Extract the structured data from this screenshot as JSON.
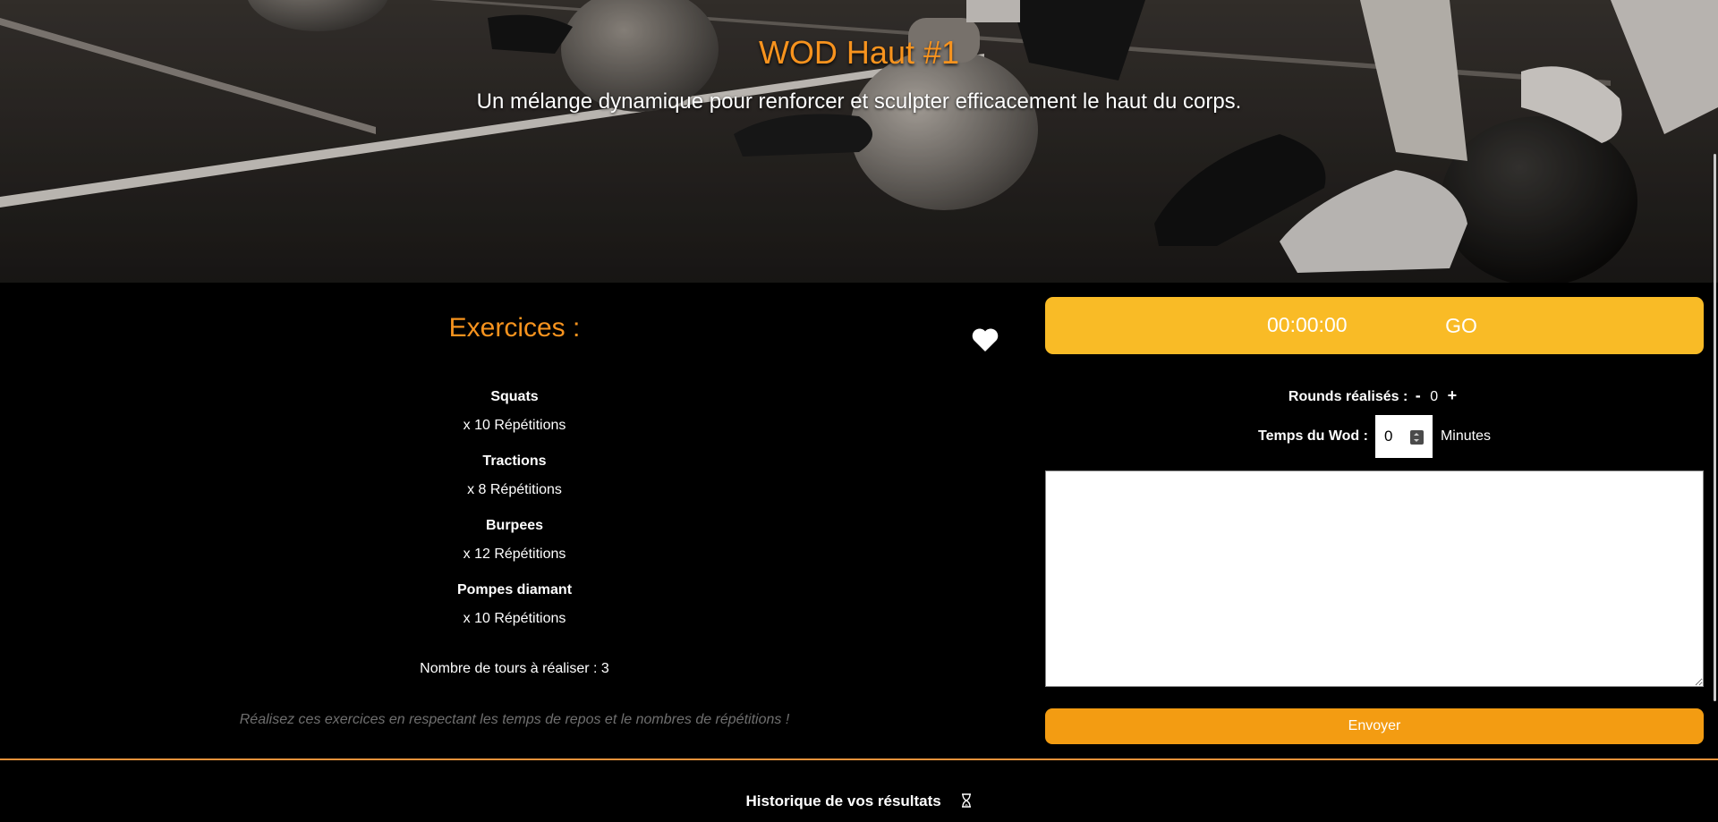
{
  "hero": {
    "title": "WOD Haut #1",
    "subtitle": "Un mélange dynamique pour renforcer et sculpter efficacement le haut du corps."
  },
  "exercises": {
    "title": "Exercices :",
    "favorite_icon": "heart-icon",
    "items": [
      {
        "name": "Squats",
        "reps": "x 10 Répétitions"
      },
      {
        "name": "Tractions",
        "reps": "x 8 Répétitions"
      },
      {
        "name": "Burpees",
        "reps": "x 12 Répétitions"
      },
      {
        "name": "Pompes diamant",
        "reps": "x 10 Répétitions"
      }
    ],
    "tours": "Nombre de tours à réaliser : 3",
    "note": "Réalisez ces exercices en respectant les temps de repos et le nombres de répétitions !"
  },
  "timer": {
    "value": "00:00:00",
    "go_label": "GO"
  },
  "rounds": {
    "label": "Rounds réalisés :",
    "minus": "-",
    "count": "0",
    "plus": "+"
  },
  "wod_time": {
    "label": "Temps du Wod :",
    "value": "0",
    "unit": "Minutes"
  },
  "comment": {
    "value": ""
  },
  "send_label": "Envoyer",
  "history": {
    "title": "Historique de vos résultats",
    "icon": "hourglass-icon"
  },
  "colors": {
    "accent_orange": "#f7931e",
    "timer_yellow": "#f9bb26",
    "send_orange": "#f39c12",
    "background": "#000000"
  }
}
